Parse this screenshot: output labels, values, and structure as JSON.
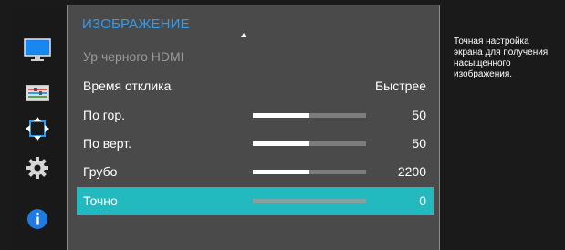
{
  "menu": {
    "title": "ИЗОБРАЖЕНИЕ",
    "items": [
      {
        "label": "Ур черного HDMI",
        "value": "",
        "disabled": true
      },
      {
        "label": "Время отклика",
        "value": "Быстрее"
      },
      {
        "label": "По гор.",
        "value": "50",
        "slider_fraction": 0.5
      },
      {
        "label": "По верт.",
        "value": "50",
        "slider_fraction": 0.5
      },
      {
        "label": "Грубо",
        "value": "2200",
        "slider_fraction": 0.5
      },
      {
        "label": "Точно",
        "value": "0",
        "slider_fraction": 0.0,
        "selected": true
      }
    ]
  },
  "sidebar": {
    "icons": [
      "picture-icon",
      "color-icon",
      "size-position-icon",
      "setup-icon",
      "information-icon"
    ]
  },
  "help": {
    "text": "Точная настройка\nэкрана для получения\nнасыщенного\nизображения."
  },
  "colors": {
    "accent_title": "#2f9cf0",
    "selected_row": "#22b9bf",
    "panel_bg": "#4a4a4a",
    "osd_bg": "#1a1a1a"
  }
}
